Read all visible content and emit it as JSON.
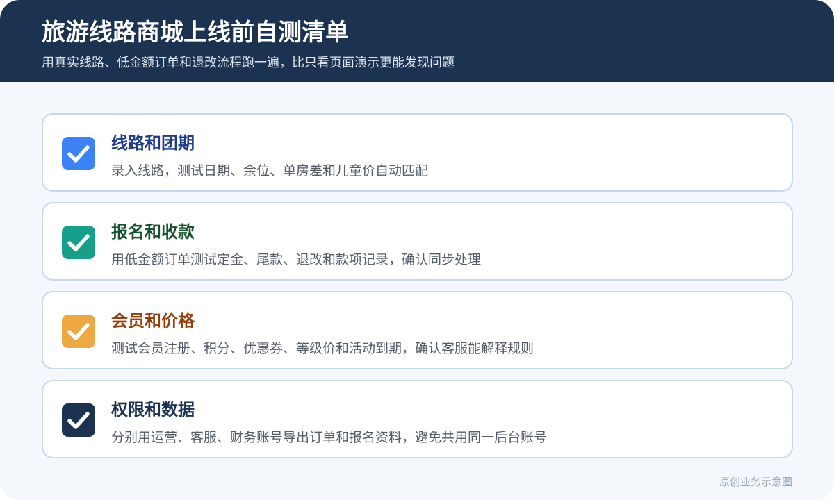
{
  "header": {
    "title": "旅游线路商城上线前自测清单",
    "subtitle": "用真实线路、低金额订单和退改流程跑一遍，比只看页面演示更能发现问题"
  },
  "items": [
    {
      "title": "线路和团期",
      "description": "录入线路，测试日期、余位、单房差和儿童价自动匹配",
      "checked": true,
      "icon": "check-icon",
      "accent_color": "#3b82f6",
      "title_color": "#1e3a8a"
    },
    {
      "title": "报名和收款",
      "description": "用低金额订单测试定金、尾款、退改和款项记录，确认同步处理",
      "checked": true,
      "icon": "check-icon",
      "accent_color": "#16a08a",
      "title_color": "#14532d"
    },
    {
      "title": "会员和价格",
      "description": "测试会员注册、积分、优惠券、等级价和活动到期，确认客服能解释规则",
      "checked": true,
      "icon": "check-icon",
      "accent_color": "#eea842",
      "title_color": "#92400e"
    },
    {
      "title": "权限和数据",
      "description": "分别用运营、客服、财务账号导出订单和报名资料，避免共用同一后台账号",
      "checked": true,
      "icon": "check-icon",
      "accent_color": "#1b3351",
      "title_color": "#1b3351"
    }
  ],
  "footer": {
    "note": "原创业务示意图"
  }
}
